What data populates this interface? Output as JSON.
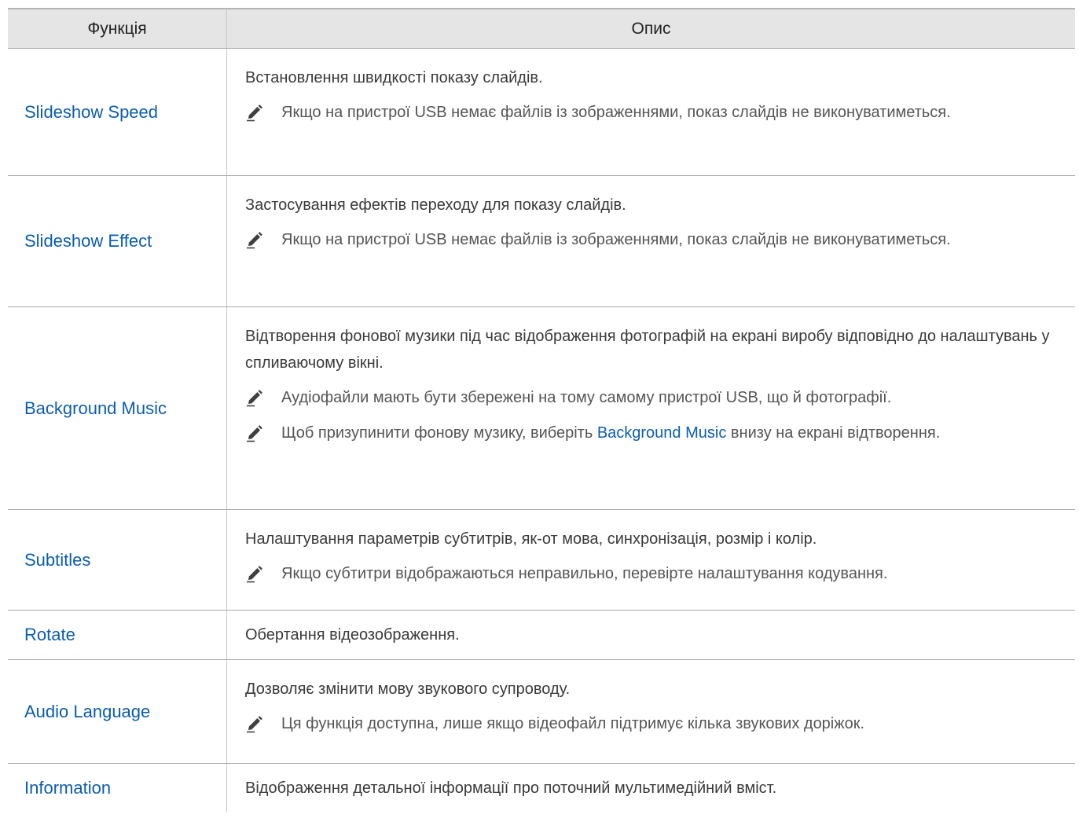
{
  "header": {
    "col_function": "Функція",
    "col_description": "Опис"
  },
  "rows": [
    {
      "function": "Slideshow Speed",
      "description": "Встановлення швидкості показу слайдів.",
      "notes": [
        "Якщо на пристрої USB немає файлів із зображеннями, показ слайдів не виконуватиметься."
      ]
    },
    {
      "function": "Slideshow Effect",
      "description": "Застосування ефектів переходу для показу слайдів.",
      "notes": [
        "Якщо на пристрої USB немає файлів із зображеннями, показ слайдів не виконуватиметься."
      ]
    },
    {
      "function": "Background Music",
      "description": "Відтворення фонової музики під час відображення фотографій на екрані виробу відповідно до налаштувань у спливаючому вікні.",
      "notes": [
        "Аудіофайли мають бути збережені на тому самому пристрої USB, що й фотографії."
      ],
      "note_with_link": {
        "before": "Щоб призупинити фонову музику, виберіть ",
        "link": "Background Music",
        "after": " внизу на екрані відтворення."
      }
    },
    {
      "function": "Subtitles",
      "description": "Налаштування параметрів субтитрів, як-от мова, синхронізація, розмір і колір.",
      "notes": [
        "Якщо субтитри відображаються неправильно, перевірте налаштування кодування."
      ]
    },
    {
      "function": "Rotate",
      "description": "Обертання відеозображення."
    },
    {
      "function": "Audio Language",
      "description": "Дозволяє змінити мову звукового супроводу.",
      "notes": [
        "Ця функція доступна, лише якщо відеофайл підтримує кілька звукових доріжок."
      ]
    },
    {
      "function": "Information",
      "description": "Відображення детальної інформації про поточний мультимедійний вміст."
    }
  ],
  "icons": {
    "note": "pencil-icon"
  },
  "colors": {
    "link": "#0b5db0",
    "header_bg": "#e5e5e5",
    "border": "#a9a9a9"
  }
}
